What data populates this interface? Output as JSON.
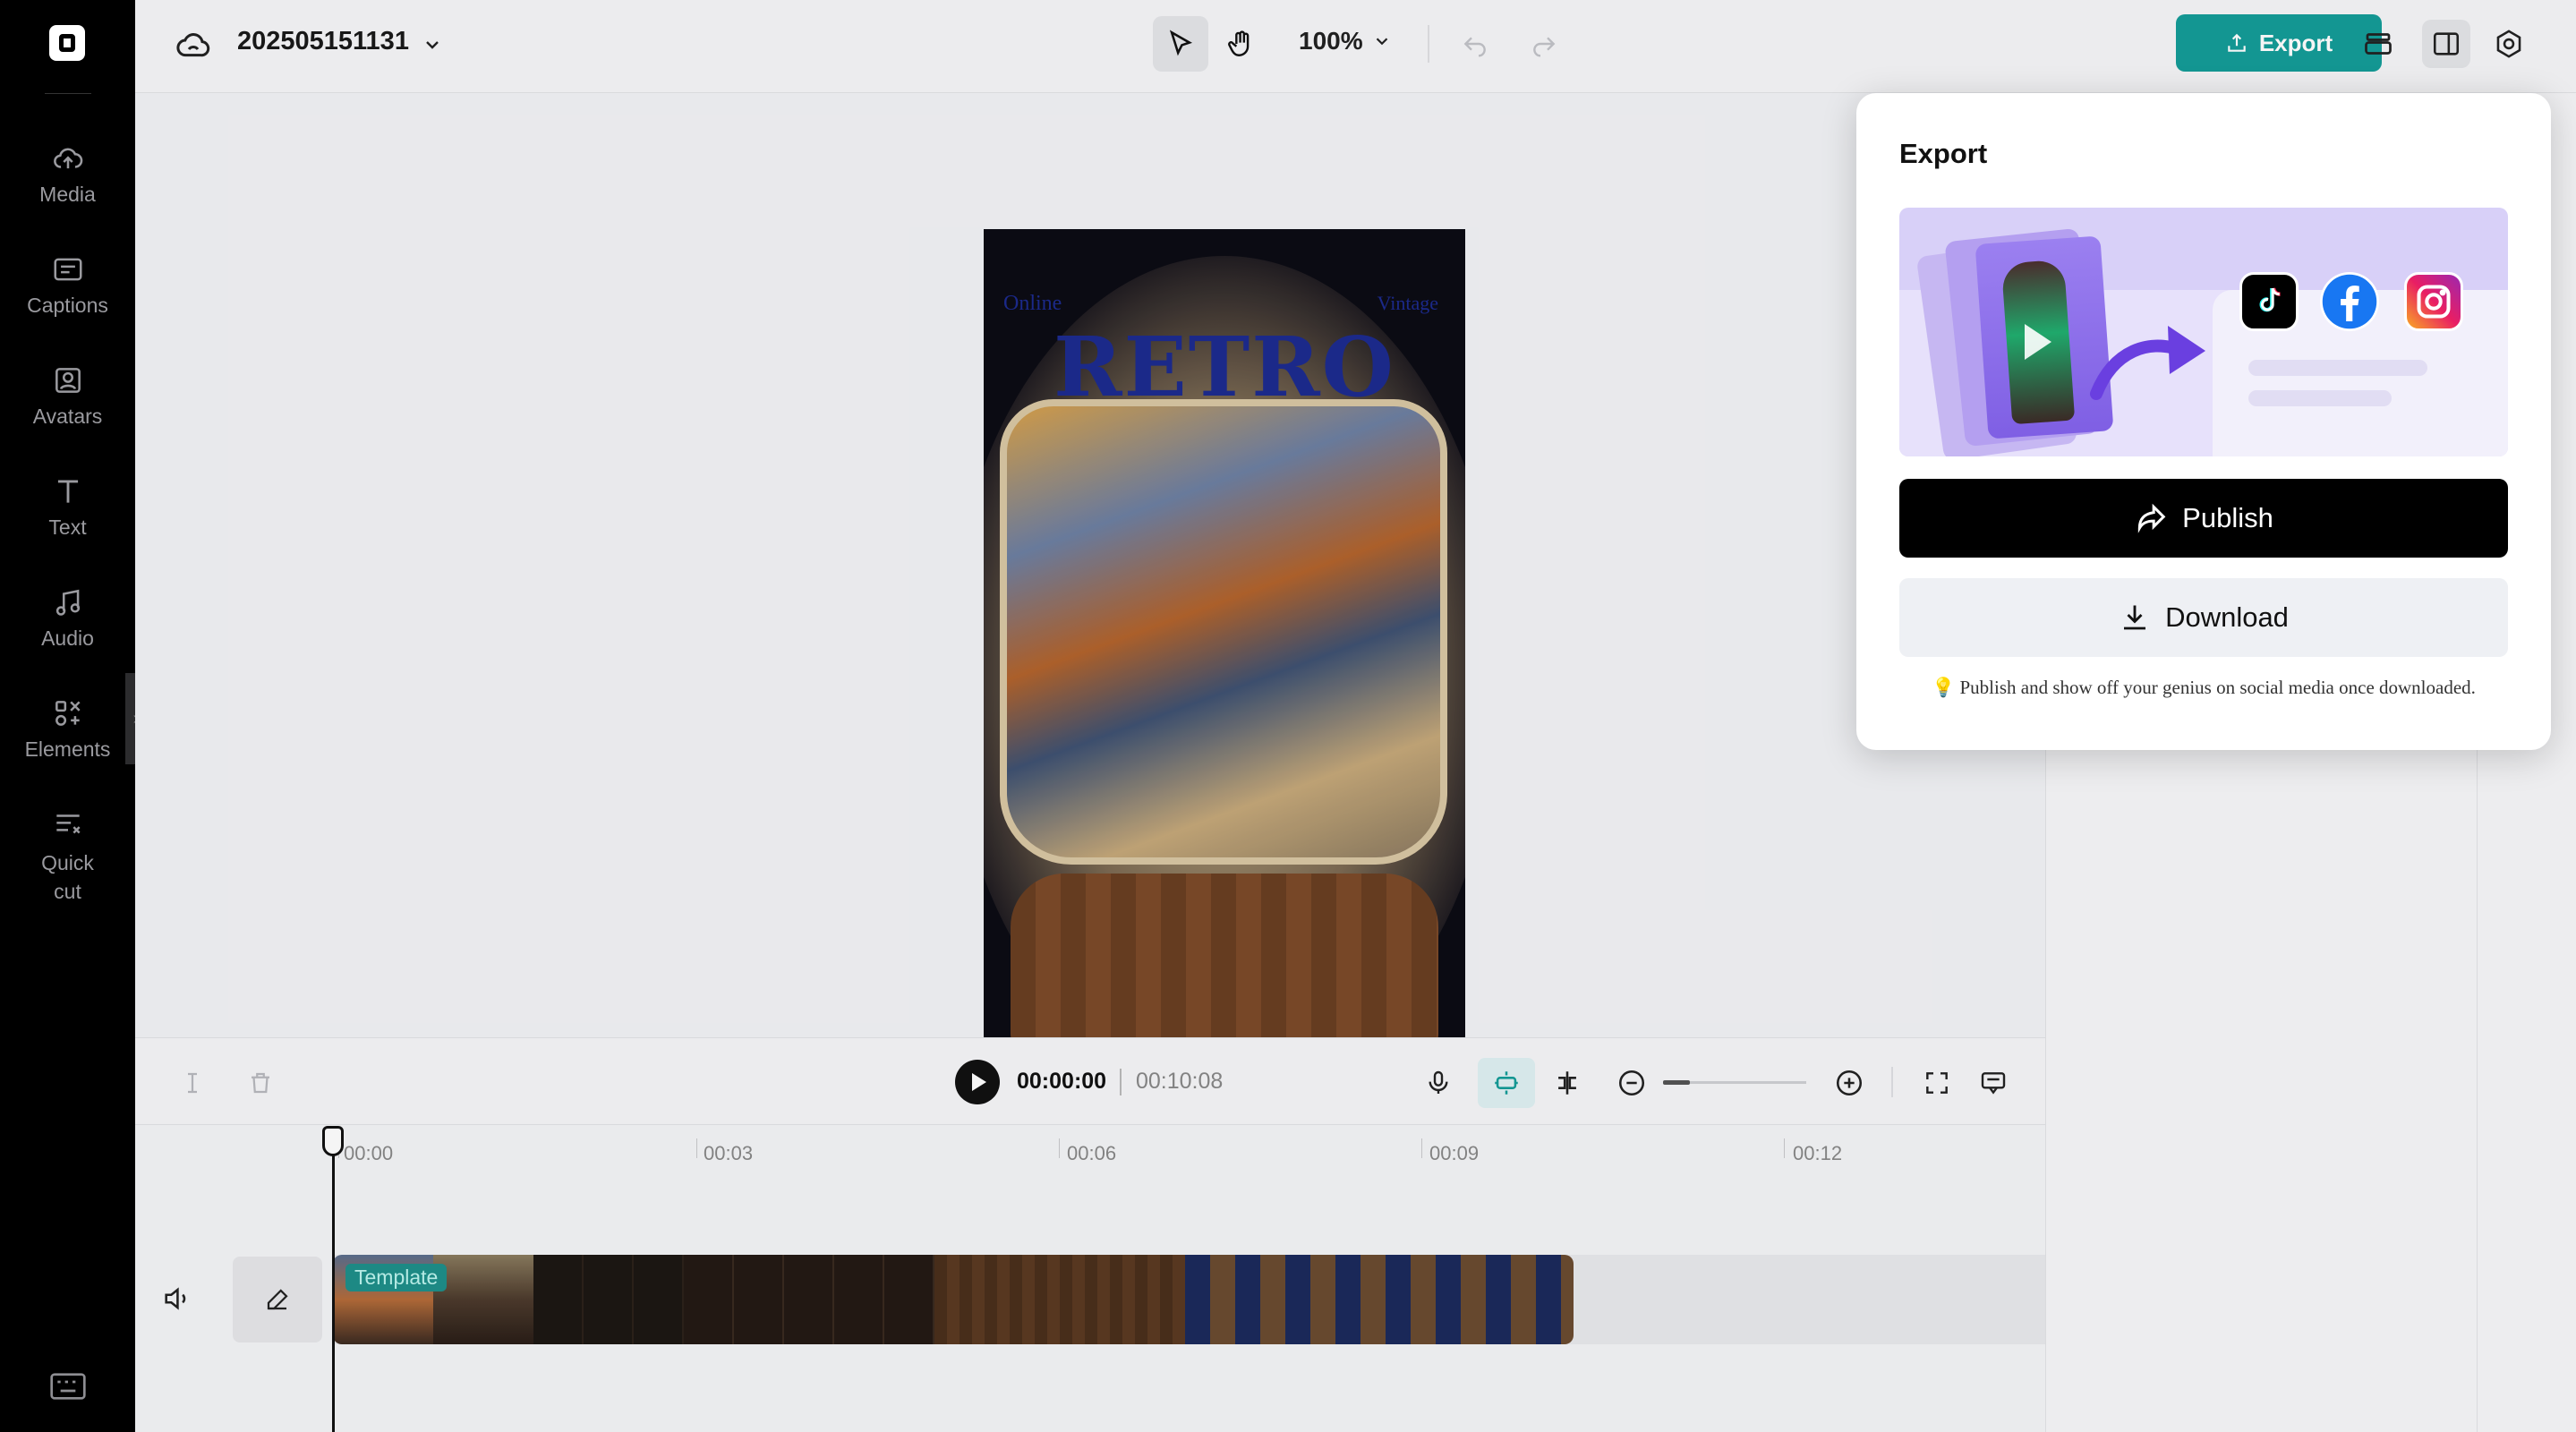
{
  "sidebar": {
    "items": [
      {
        "label": "Media",
        "icon": "cloud-upload-icon"
      },
      {
        "label": "Captions",
        "icon": "captions-icon"
      },
      {
        "label": "Avatars",
        "icon": "avatar-icon"
      },
      {
        "label": "Text",
        "icon": "text-icon"
      },
      {
        "label": "Audio",
        "icon": "music-note-icon"
      },
      {
        "label": "Elements",
        "icon": "elements-icon"
      },
      {
        "label": "Quick cut",
        "icon": "quick-cut-icon"
      }
    ]
  },
  "header": {
    "project_name": "202505151131",
    "zoom": "100%",
    "export_label": "Export"
  },
  "preview": {
    "title": "RETRO",
    "tag_left": "Online",
    "tag_right": "Vintage"
  },
  "timeline": {
    "current_time": "00:00:00",
    "total_time": "00:10:08",
    "ruler": [
      "00:00",
      "00:03",
      "00:06",
      "00:09",
      "00:12"
    ],
    "clip_label": "Template"
  },
  "export_popup": {
    "title": "Export",
    "publish_label": "Publish",
    "download_label": "Download",
    "hint": "💡 Publish and show off your genius on social media once downloaded."
  },
  "colors": {
    "accent": "#149d98",
    "sidebar_bg": "#000000",
    "retro_title": "#1d2b8f"
  }
}
